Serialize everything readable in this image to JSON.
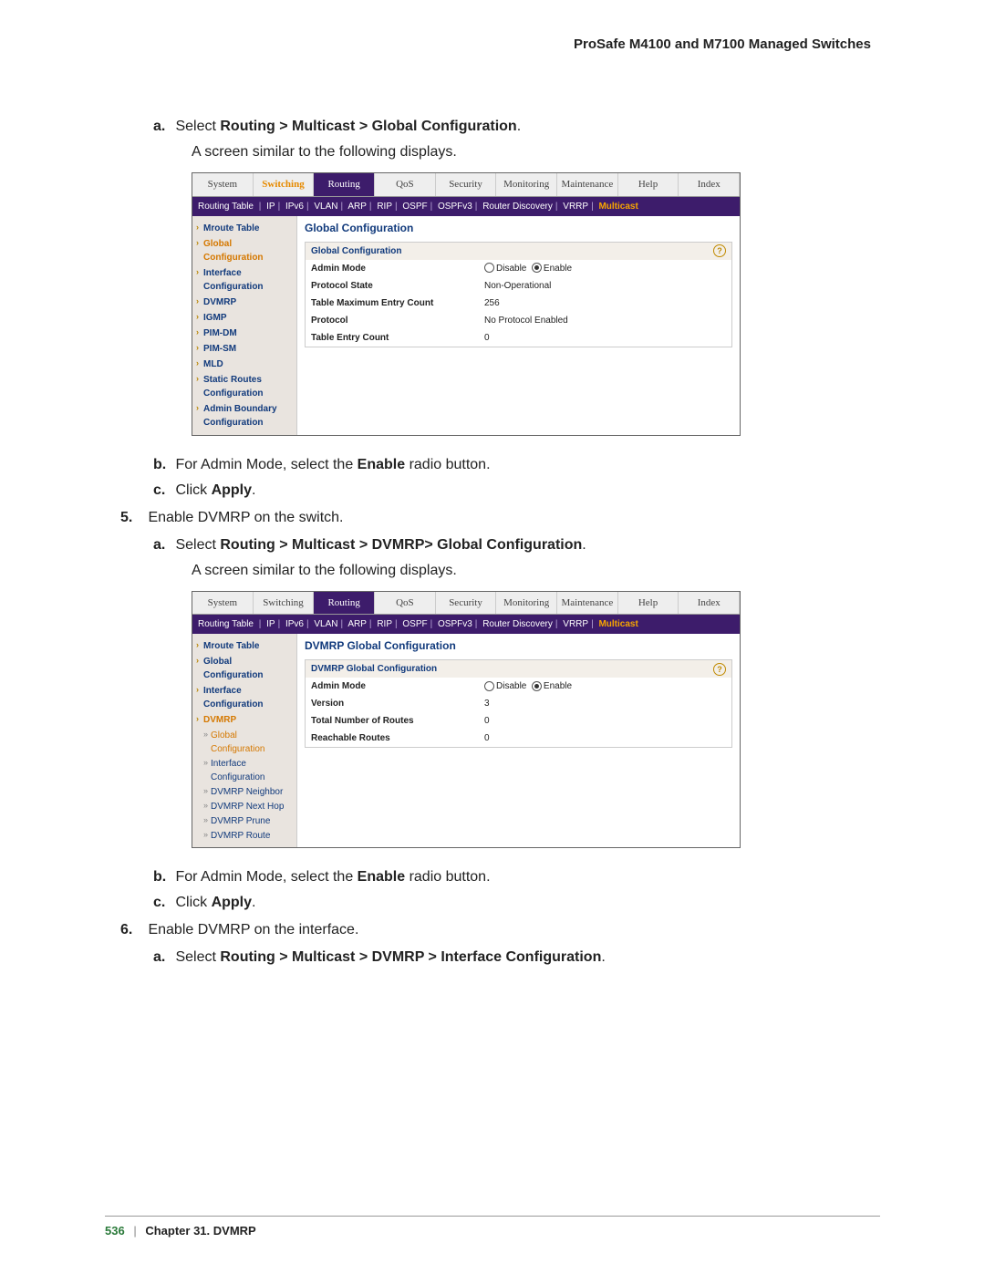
{
  "header": "ProSafe M4100 and M7100 Managed Switches",
  "steps": {
    "s4a_pre": "Select ",
    "s4a_bold": "Routing > Multicast > Global Configuration",
    "s4a_post": ".",
    "s4a_body": "A screen similar to the following displays.",
    "s4b_pre": "For Admin Mode, select the ",
    "s4b_bold": "Enable",
    "s4b_post": " radio button.",
    "s4c_pre": "Click ",
    "s4c_bold": "Apply",
    "s4c_post": ".",
    "s5": "Enable DVMRP on the switch.",
    "s5a_pre": "Select ",
    "s5a_bold": "Routing > Multicast > DVMRP> Global Configuration",
    "s5a_post": ".",
    "s5a_body": "A screen similar to the following displays.",
    "s5b_pre": "For Admin Mode, select the ",
    "s5b_bold": "Enable",
    "s5b_post": " radio button.",
    "s5c_pre": "Click ",
    "s5c_bold": "Apply",
    "s5c_post": ".",
    "s6": "Enable DVMRP on the interface.",
    "s6a_pre": "Select ",
    "s6a_bold": "Routing > Multicast > DVMRP > Interface Configuration",
    "s6a_post": "."
  },
  "markers": {
    "a": "a.",
    "b": "b.",
    "c": "c.",
    "n5": "5.",
    "n6": "6."
  },
  "ss1": {
    "tabs": [
      "System",
      "Switching",
      "Routing",
      "QoS",
      "Security",
      "Monitoring",
      "Maintenance",
      "Help",
      "Index"
    ],
    "active_tab": "Routing",
    "orange_tab": "Switching",
    "subtabs_left": "Routing Table ",
    "subtabs": [
      "IP",
      "IPv6",
      "VLAN",
      "ARP",
      "RIP",
      "OSPF",
      "OSPFv3",
      "Router Discovery",
      "VRRP"
    ],
    "subtabs_active": "Multicast",
    "side": [
      "Mroute Table",
      "Global Configuration",
      "Interface Configuration",
      "DVMRP",
      "IGMP",
      "PIM-DM",
      "PIM-SM",
      "MLD",
      "Static Routes Configuration",
      "Admin Boundary Configuration"
    ],
    "side_selected": "Global Configuration",
    "panel_title": "Global Configuration",
    "panel_sub": "Global Configuration",
    "rows": [
      {
        "k": "Admin Mode",
        "v": "",
        "radio": true,
        "opt1": "Disable",
        "opt2": "Enable",
        "on": 2
      },
      {
        "k": "Protocol State",
        "v": "Non-Operational"
      },
      {
        "k": "Table Maximum Entry Count",
        "v": "256"
      },
      {
        "k": "Protocol",
        "v": "No Protocol Enabled"
      },
      {
        "k": "Table Entry Count",
        "v": "0"
      }
    ]
  },
  "ss2": {
    "tabs": [
      "System",
      "Switching",
      "Routing",
      "QoS",
      "Security",
      "Monitoring",
      "Maintenance",
      "Help",
      "Index"
    ],
    "active_tab": "Routing",
    "subtabs_left": "Routing Table ",
    "subtabs": [
      "IP",
      "IPv6",
      "VLAN",
      "ARP",
      "RIP",
      "OSPF",
      "OSPFv3",
      "Router Discovery",
      "VRRP"
    ],
    "subtabs_active": "Multicast",
    "side_top": [
      "Mroute Table",
      "Global Configuration",
      "Interface Configuration"
    ],
    "side_sel": "DVMRP",
    "side_subs": [
      "Global Configuration",
      "Interface Configuration",
      "DVMRP Neighbor",
      "DVMRP Next Hop",
      "DVMRP Prune",
      "DVMRP Route"
    ],
    "side_sub_sel": "Global Configuration",
    "panel_title": "DVMRP Global Configuration",
    "panel_sub": "DVMRP Global Configuration",
    "rows": [
      {
        "k": "Admin Mode",
        "v": "",
        "radio": true,
        "opt1": "Disable",
        "opt2": "Enable",
        "on": 2
      },
      {
        "k": "Version",
        "v": "3"
      },
      {
        "k": "Total Number of Routes",
        "v": "0"
      },
      {
        "k": "Reachable Routes",
        "v": "0"
      }
    ]
  },
  "footer": {
    "page": "536",
    "chapter": "Chapter 31.  DVMRP"
  }
}
